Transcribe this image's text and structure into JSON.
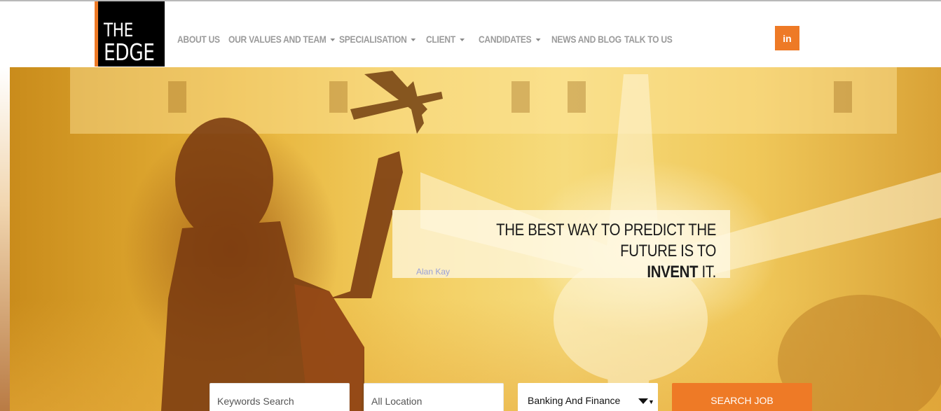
{
  "logo": {
    "line1": "THE",
    "line2": "EDGE"
  },
  "nav": [
    {
      "label": "ABOUT US",
      "dropdown": false
    },
    {
      "label": "OUR VALUES AND TEAM",
      "dropdown": true
    },
    {
      "label": "SPECIALISATION",
      "dropdown": true
    },
    {
      "label": "CLIENT",
      "dropdown": true
    },
    {
      "label": "CANDIDATES",
      "dropdown": true
    },
    {
      "label": "NEWS AND BLOG",
      "dropdown": false
    },
    {
      "label": "TALK TO US",
      "dropdown": false
    }
  ],
  "social": {
    "linkedin_label": "in",
    "icon": "linkedin-icon"
  },
  "hero": {
    "quote_main": "THE BEST WAY TO PREDICT THE FUTURE IS TO",
    "quote_emphasis": "INVENT",
    "quote_end": "IT.",
    "author": "Alan Kay"
  },
  "search": {
    "keywords_placeholder": "Keywords Search",
    "location_placeholder": "All Location",
    "category_selected": "Banking And Finance",
    "button_label": "SEARCH JOB"
  },
  "colors": {
    "accent": "#ee7a26",
    "nav_text": "#9b9b9b",
    "logo_bg": "#000000"
  }
}
